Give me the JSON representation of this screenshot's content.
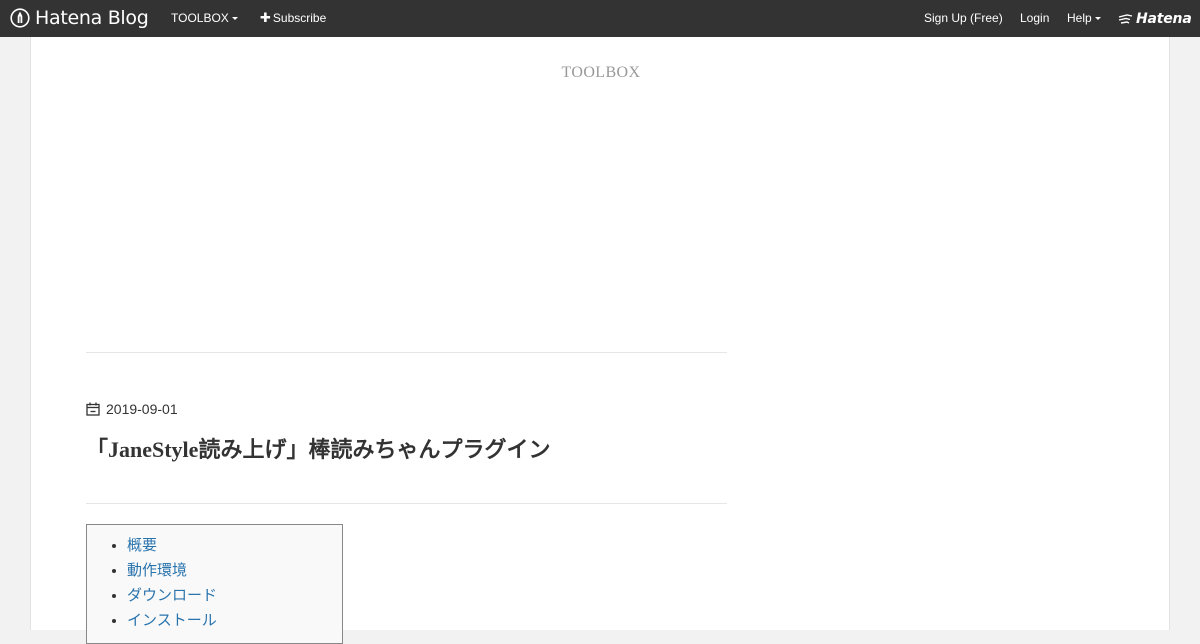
{
  "header": {
    "logo_text": "Hatena Blog",
    "blog_menu_label": "TOOLBOX",
    "subscribe_label": "Subscribe",
    "signup_label": "Sign Up (Free)",
    "login_label": "Login",
    "help_label": "Help",
    "brand_label": "Hatena",
    "bar_color": "#333333"
  },
  "blog": {
    "title": "TOOLBOX"
  },
  "entry": {
    "date": "2019-09-01",
    "title": "「JaneStyle読み上げ」棒読みちゃんプラグイン"
  },
  "toc": {
    "items": [
      {
        "label": "概要"
      },
      {
        "label": "動作環境"
      },
      {
        "label": "ダウンロード"
      },
      {
        "label": "インストール"
      }
    ],
    "link_color": "#2a74ad"
  },
  "icons": {
    "logo": "hatena-blog-pen-icon",
    "date": "calendar-icon",
    "brand": "hatena-bird-icon"
  }
}
